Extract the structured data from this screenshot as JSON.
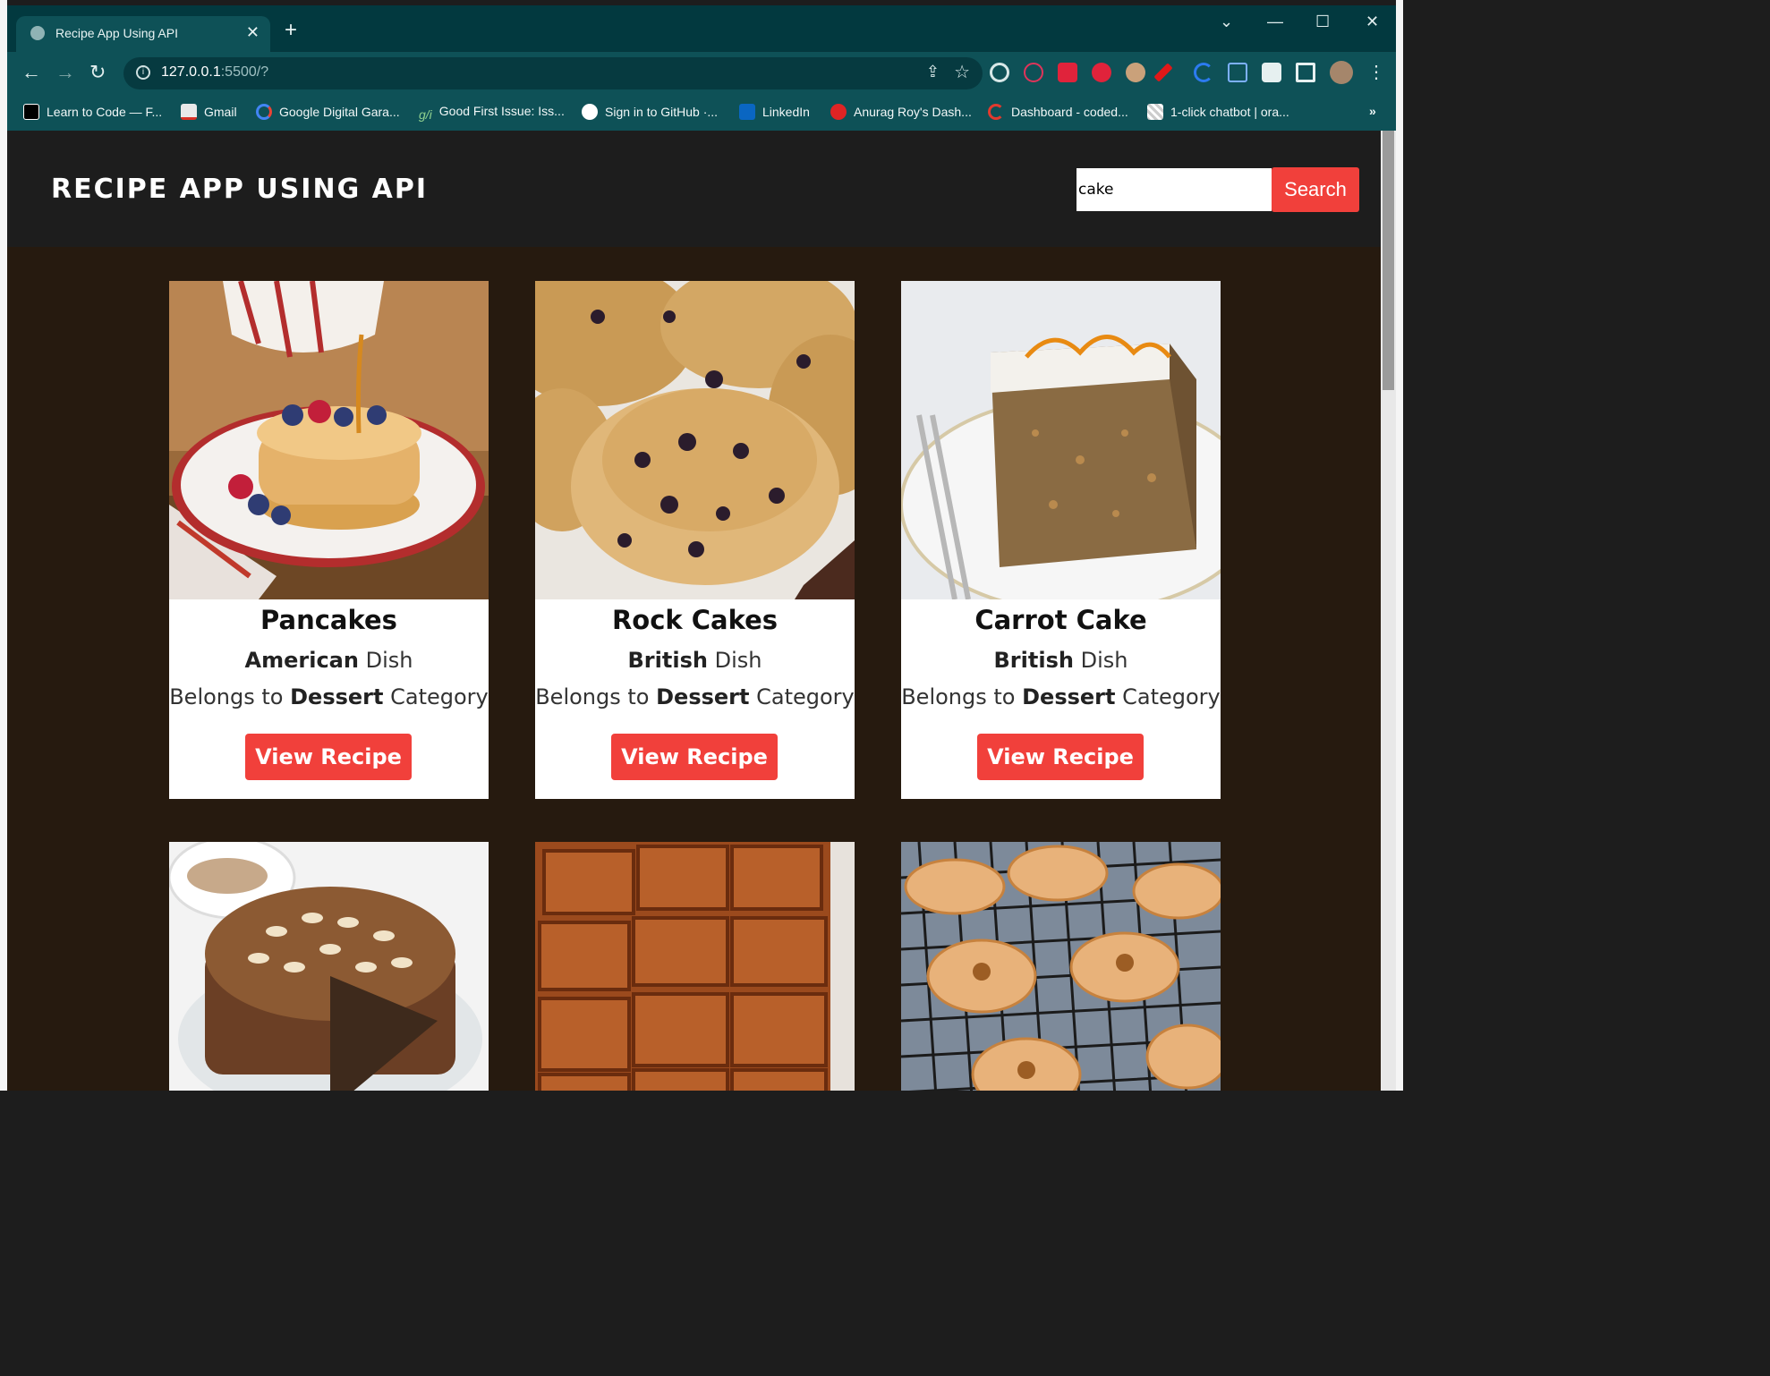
{
  "browser": {
    "tab_title": "Recipe App Using API",
    "new_tab": "+",
    "close_tab": "✕",
    "url_host": "127.0.0.1",
    "url_path": ":5500/?",
    "back": "←",
    "forward": "→",
    "reload": "↻",
    "win_dropdown": "⌄",
    "win_min": "—",
    "win_max": "☐",
    "win_close": "✕",
    "bookmarks": [
      "Learn to Code — F...",
      "Gmail",
      "Google Digital Gara...",
      "Good First Issue: Iss...",
      "Sign in to GitHub ·...",
      "LinkedIn",
      "Anurag Roy's Dash...",
      "Dashboard - coded...",
      "1-click chatbot | ora..."
    ],
    "bookmarks_more": "»"
  },
  "header": {
    "title": "RECIPE APP USING API",
    "search_value": "cake",
    "search_button": "Search"
  },
  "recipes": [
    {
      "name": "Pancakes",
      "area": "American",
      "category": "Dessert"
    },
    {
      "name": "Rock Cakes",
      "area": "British",
      "category": "Dessert"
    },
    {
      "name": "Carrot Cake",
      "area": "British",
      "category": "Dessert"
    }
  ],
  "labels": {
    "dish": "Dish",
    "belongs_to": "Belongs to",
    "category": "Category",
    "view_recipe": "View Recipe"
  },
  "colors": {
    "accent": "#f1403b",
    "page_bg": "#261a0f",
    "header_bg": "#1d1d1d",
    "chrome_bg": "#0e5157"
  }
}
